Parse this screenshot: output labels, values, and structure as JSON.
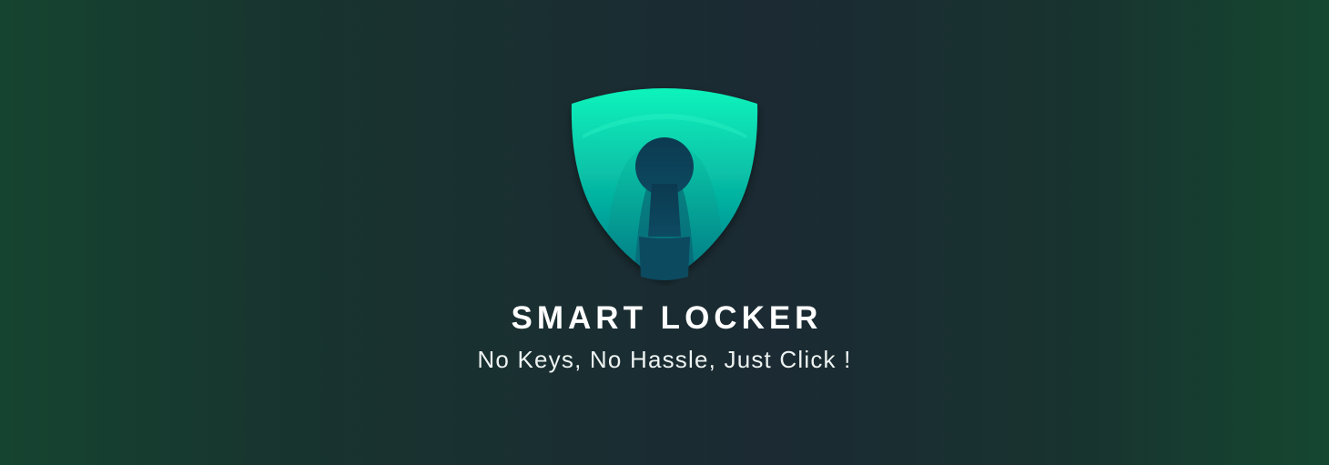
{
  "brand": {
    "logo_icon": "shield-keyhole-icon",
    "title": "SMART LOCKER",
    "tagline": "No Keys, No Hassle, Just Click !"
  },
  "colors": {
    "background_dark": "#1b2a33",
    "background_green": "#154430",
    "shield_top": "#0ff0ba",
    "shield_bottom": "#017f8c",
    "keyhole": "#0c3f55",
    "text": "#ffffff"
  }
}
